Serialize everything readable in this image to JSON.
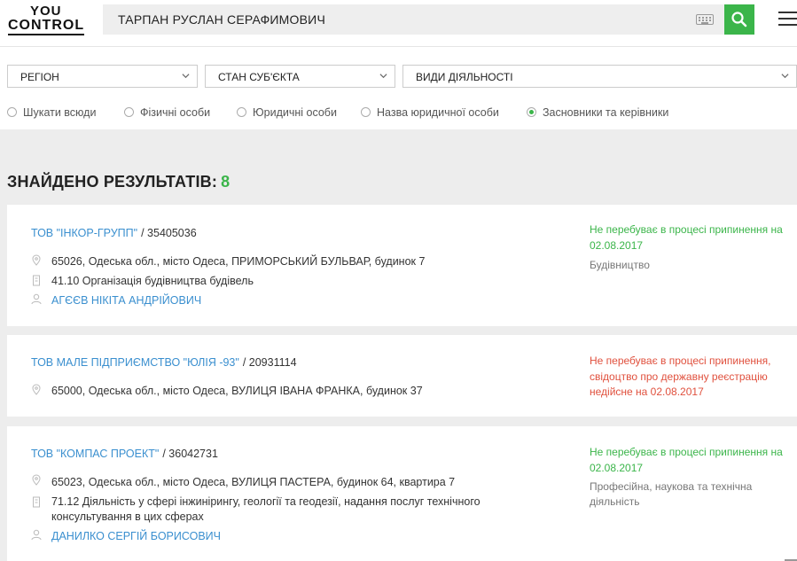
{
  "logo": {
    "line1": "YOU",
    "line2": "CONTROL"
  },
  "search": {
    "query": "ТАРПАН РУСЛАН СЕРАФИМОВИЧ"
  },
  "filters": {
    "region": "РЕГІОН",
    "state": "СТАН СУБ'ЄКТА",
    "activities": "ВИДИ ДІЯЛЬНОСТІ"
  },
  "radios": [
    {
      "label": "Шукати всюди",
      "checked": false
    },
    {
      "label": "Фізичні особи",
      "checked": false
    },
    {
      "label": "Юридичні особи",
      "checked": false
    },
    {
      "label": "Назва юридичної особи",
      "checked": false
    },
    {
      "label": "Засновники та керівники",
      "checked": true
    }
  ],
  "results": {
    "label": "ЗНАЙДЕНО РЕЗУЛЬТАТІВ:",
    "count": "8",
    "items": [
      {
        "name": "ТОВ \"ІНКОР-ГРУПП\"",
        "code": "/ 35405036",
        "address": "65026, Одеська обл., місто Одеса, ПРИМОРСЬКИЙ БУЛЬВАР, будинок 7",
        "activity": "41.10 Організація будівництва будівель",
        "person": "АГЄЄВ НІКІТА АНДРІЙОВИЧ",
        "status": "Не перебуває в процесі припинення на 02.08.2017",
        "sector": "Будівництво"
      },
      {
        "name": "ТОВ МАЛЕ ПІДПРИЄМСТВО \"ЮЛІЯ -93\"",
        "code": "/ 20931114",
        "address": "65000, Одеська обл., місто Одеса, ВУЛИЦЯ ІВАНА ФРАНКА, будинок 37",
        "status": "Не перебуває в процесі припинення, свідоцтво про державну реєстрацію недійсне на 02.08.2017"
      },
      {
        "name": "ТОВ \"КОМПАС ПРОЕКТ\"",
        "code": "/ 36042731",
        "address": "65023, Одеська обл., місто Одеса, ВУЛИЦЯ ПАСТЕРА, будинок 64, квартира 7",
        "activity": "71.12 Діяльність у сфері інжинірингу, геології та геодезії, надання послуг технічного консультування в цих сферах",
        "person": "ДАНИЛКО СЕРГІЙ БОРИСОВИЧ",
        "status": "Не перебуває в процесі припинення на 02.08.2017",
        "sector": "Професійна, наукова та технічна діяльність"
      }
    ]
  },
  "colors": {
    "accent": "#3bb54a",
    "link": "#3a8fcf",
    "error": "#e0503d",
    "panel_bg": "#ededed"
  },
  "icons": [
    "keyboard-icon",
    "search-icon",
    "menu-icon",
    "chevron-down-icon",
    "map-pin-icon",
    "building-icon",
    "person-icon"
  ]
}
